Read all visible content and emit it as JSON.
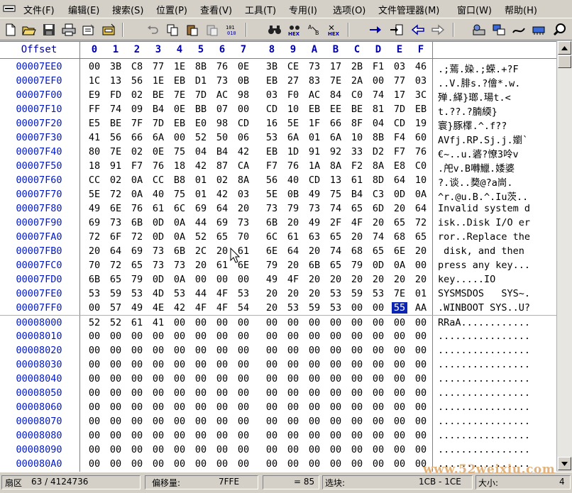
{
  "menu": {
    "items": [
      "文件(F)",
      "编辑(E)",
      "搜索(S)",
      "位置(P)",
      "查看(V)",
      "工具(T)",
      "专用(I)",
      "选项(O)",
      "文件管理器(M)",
      "窗口(W)",
      "帮助(H)"
    ]
  },
  "toolbar": {
    "icons": [
      "new-file-icon",
      "open-folder-icon",
      "save-disk-icon",
      "print-icon",
      "properties-icon",
      "open-disk-icon",
      "undo-icon",
      "copy-icon",
      "paste-icon",
      "paste-write-icon",
      "convert-binary-icon",
      "find-binoculars-icon",
      "find-hex-icon",
      "replace-icon",
      "replace-hex-icon",
      "goto-arrow-icon",
      "goto-offset-icon",
      "back-arrow-icon",
      "forward-arrow-icon",
      "disk-tools-icon",
      "windows-icon",
      "cable-icon",
      "memory-icon",
      "search-magnifier-icon"
    ]
  },
  "header": {
    "offset_label": "Offset",
    "columns": [
      "0",
      "1",
      "2",
      "3",
      "4",
      "5",
      "6",
      "7",
      "8",
      "9",
      "A",
      "B",
      "C",
      "D",
      "E",
      "F"
    ]
  },
  "rows": [
    {
      "offset": "00007EE0",
      "hex": [
        "00",
        "3B",
        "C8",
        "77",
        "1E",
        "8B",
        "76",
        "0E",
        "3B",
        "CE",
        "73",
        "17",
        "2B",
        "F1",
        "03",
        "46"
      ],
      "ascii": ".;蔫.媣.;蝾.+?F"
    },
    {
      "offset": "00007EF0",
      "hex": [
        "1C",
        "13",
        "56",
        "1E",
        "EB",
        "D1",
        "73",
        "0B",
        "EB",
        "27",
        "83",
        "7E",
        "2A",
        "00",
        "77",
        "03"
      ],
      "ascii": "..V.腓s.?儈*.w."
    },
    {
      "offset": "00007F00",
      "hex": [
        "E9",
        "FD",
        "02",
        "BE",
        "7E",
        "7D",
        "AC",
        "98",
        "03",
        "F0",
        "AC",
        "84",
        "C0",
        "74",
        "17",
        "3C"
      ],
      "ascii": "殚.緙}瑯.瑒t.<"
    },
    {
      "offset": "00007F10",
      "hex": [
        "FF",
        "74",
        "09",
        "B4",
        "0E",
        "BB",
        "07",
        "00",
        "CD",
        "10",
        "EB",
        "EE",
        "BE",
        "81",
        "7D",
        "EB"
      ],
      "ascii": "t.??.?腩緛}"
    },
    {
      "offset": "00007F20",
      "hex": [
        "E5",
        "BE",
        "7F",
        "7D",
        "EB",
        "E0",
        "98",
        "CD",
        "16",
        "5E",
        "1F",
        "66",
        "8F",
        "04",
        "CD",
        "19"
      ],
      "ascii": "寰}豚檡.^.f??"
    },
    {
      "offset": "00007F30",
      "hex": [
        "41",
        "56",
        "66",
        "6A",
        "00",
        "52",
        "50",
        "06",
        "53",
        "6A",
        "01",
        "6A",
        "10",
        "8B",
        "F4",
        "60"
      ],
      "ascii": "AVfj.RP.Sj.j.嬼`"
    },
    {
      "offset": "00007F40",
      "hex": [
        "80",
        "7E",
        "02",
        "0E",
        "75",
        "04",
        "B4",
        "42",
        "EB",
        "1D",
        "91",
        "92",
        "33",
        "D2",
        "F7",
        "76"
      ],
      "ascii": "€~..u.碆?憭3呤v"
    },
    {
      "offset": "00007F50",
      "hex": [
        "18",
        "91",
        "F7",
        "76",
        "18",
        "42",
        "87",
        "CA",
        "F7",
        "76",
        "1A",
        "8A",
        "F2",
        "8A",
        "E8",
        "C0"
      ],
      "ascii": ".戺v.B囀鱲.婑婆"
    },
    {
      "offset": "00007F60",
      "hex": [
        "CC",
        "02",
        "0A",
        "CC",
        "B8",
        "01",
        "02",
        "8A",
        "56",
        "40",
        "CD",
        "13",
        "61",
        "8D",
        "64",
        "10"
      ],
      "ascii": "?.谈..奦@?a峝."
    },
    {
      "offset": "00007F70",
      "hex": [
        "5E",
        "72",
        "0A",
        "40",
        "75",
        "01",
        "42",
        "03",
        "5E",
        "0B",
        "49",
        "75",
        "B4",
        "C3",
        "0D",
        "0A"
      ],
      "ascii": "^r.@u.B.^.Iu茨.."
    },
    {
      "offset": "00007F80",
      "hex": [
        "49",
        "6E",
        "76",
        "61",
        "6C",
        "69",
        "64",
        "20",
        "73",
        "79",
        "73",
        "74",
        "65",
        "6D",
        "20",
        "64"
      ],
      "ascii": "Invalid system d"
    },
    {
      "offset": "00007F90",
      "hex": [
        "69",
        "73",
        "6B",
        "0D",
        "0A",
        "44",
        "69",
        "73",
        "6B",
        "20",
        "49",
        "2F",
        "4F",
        "20",
        "65",
        "72"
      ],
      "ascii": "isk..Disk I/O er"
    },
    {
      "offset": "00007FA0",
      "hex": [
        "72",
        "6F",
        "72",
        "0D",
        "0A",
        "52",
        "65",
        "70",
        "6C",
        "61",
        "63",
        "65",
        "20",
        "74",
        "68",
        "65"
      ],
      "ascii": "ror..Replace the"
    },
    {
      "offset": "00007FB0",
      "hex": [
        "20",
        "64",
        "69",
        "73",
        "6B",
        "2C",
        "20",
        "61",
        "6E",
        "64",
        "20",
        "74",
        "68",
        "65",
        "6E",
        "20"
      ],
      "ascii": " disk, and then "
    },
    {
      "offset": "00007FC0",
      "hex": [
        "70",
        "72",
        "65",
        "73",
        "73",
        "20",
        "61",
        "6E",
        "79",
        "20",
        "6B",
        "65",
        "79",
        "0D",
        "0A",
        "00"
      ],
      "ascii": "press any key..."
    },
    {
      "offset": "00007FD0",
      "hex": [
        "6B",
        "65",
        "79",
        "0D",
        "0A",
        "00",
        "00",
        "00",
        "49",
        "4F",
        "20",
        "20",
        "20",
        "20",
        "20",
        "20"
      ],
      "ascii": "key.....IO      "
    },
    {
      "offset": "00007FE0",
      "hex": [
        "53",
        "59",
        "53",
        "4D",
        "53",
        "44",
        "4F",
        "53",
        "20",
        "20",
        "20",
        "53",
        "59",
        "53",
        "7E",
        "01"
      ],
      "ascii": "SYSMSDOS   SYS~."
    },
    {
      "offset": "00007FF0",
      "hex": [
        "00",
        "57",
        "49",
        "4E",
        "42",
        "4F",
        "4F",
        "54",
        "20",
        "53",
        "59",
        "53",
        "00",
        "00",
        "55",
        "AA"
      ],
      "ascii": ".WINBOOT SYS..U?"
    },
    {
      "offset": "00008000",
      "hex": [
        "52",
        "52",
        "61",
        "41",
        "00",
        "00",
        "00",
        "00",
        "00",
        "00",
        "00",
        "00",
        "00",
        "00",
        "00",
        "00"
      ],
      "ascii": "RRaA............"
    },
    {
      "offset": "00008010",
      "hex": [
        "00",
        "00",
        "00",
        "00",
        "00",
        "00",
        "00",
        "00",
        "00",
        "00",
        "00",
        "00",
        "00",
        "00",
        "00",
        "00"
      ],
      "ascii": "................"
    },
    {
      "offset": "00008020",
      "hex": [
        "00",
        "00",
        "00",
        "00",
        "00",
        "00",
        "00",
        "00",
        "00",
        "00",
        "00",
        "00",
        "00",
        "00",
        "00",
        "00"
      ],
      "ascii": "................"
    },
    {
      "offset": "00008030",
      "hex": [
        "00",
        "00",
        "00",
        "00",
        "00",
        "00",
        "00",
        "00",
        "00",
        "00",
        "00",
        "00",
        "00",
        "00",
        "00",
        "00"
      ],
      "ascii": "................"
    },
    {
      "offset": "00008040",
      "hex": [
        "00",
        "00",
        "00",
        "00",
        "00",
        "00",
        "00",
        "00",
        "00",
        "00",
        "00",
        "00",
        "00",
        "00",
        "00",
        "00"
      ],
      "ascii": "................"
    },
    {
      "offset": "00008050",
      "hex": [
        "00",
        "00",
        "00",
        "00",
        "00",
        "00",
        "00",
        "00",
        "00",
        "00",
        "00",
        "00",
        "00",
        "00",
        "00",
        "00"
      ],
      "ascii": "................"
    },
    {
      "offset": "00008060",
      "hex": [
        "00",
        "00",
        "00",
        "00",
        "00",
        "00",
        "00",
        "00",
        "00",
        "00",
        "00",
        "00",
        "00",
        "00",
        "00",
        "00"
      ],
      "ascii": "................"
    },
    {
      "offset": "00008070",
      "hex": [
        "00",
        "00",
        "00",
        "00",
        "00",
        "00",
        "00",
        "00",
        "00",
        "00",
        "00",
        "00",
        "00",
        "00",
        "00",
        "00"
      ],
      "ascii": "................"
    },
    {
      "offset": "00008080",
      "hex": [
        "00",
        "00",
        "00",
        "00",
        "00",
        "00",
        "00",
        "00",
        "00",
        "00",
        "00",
        "00",
        "00",
        "00",
        "00",
        "00"
      ],
      "ascii": "................"
    },
    {
      "offset": "00008090",
      "hex": [
        "00",
        "00",
        "00",
        "00",
        "00",
        "00",
        "00",
        "00",
        "00",
        "00",
        "00",
        "00",
        "00",
        "00",
        "00",
        "00"
      ],
      "ascii": "................"
    },
    {
      "offset": "000080A0",
      "hex": [
        "00",
        "00",
        "00",
        "00",
        "00",
        "00",
        "00",
        "00",
        "00",
        "00",
        "00",
        "00",
        "00",
        "00",
        "00",
        "00"
      ],
      "ascii": "................"
    }
  ],
  "selection": {
    "row_offset": "00007FF0",
    "column": "E"
  },
  "status": {
    "sector_label": "扇区",
    "sector_value": "63 / 4124736",
    "offset_label": "偏移量:",
    "offset_value": "7FFE",
    "eq_value": "= 85",
    "block_label": "选块:",
    "block_value": "1CB - 1CE",
    "size_label": "大小:",
    "size_value": "4"
  },
  "watermark": "www.52weixiu.com",
  "colors": {
    "offset_blue": "#0018c8",
    "header_blue": "#0000aa",
    "selection": "#0b24b6",
    "chrome": "#d4d0c8"
  }
}
